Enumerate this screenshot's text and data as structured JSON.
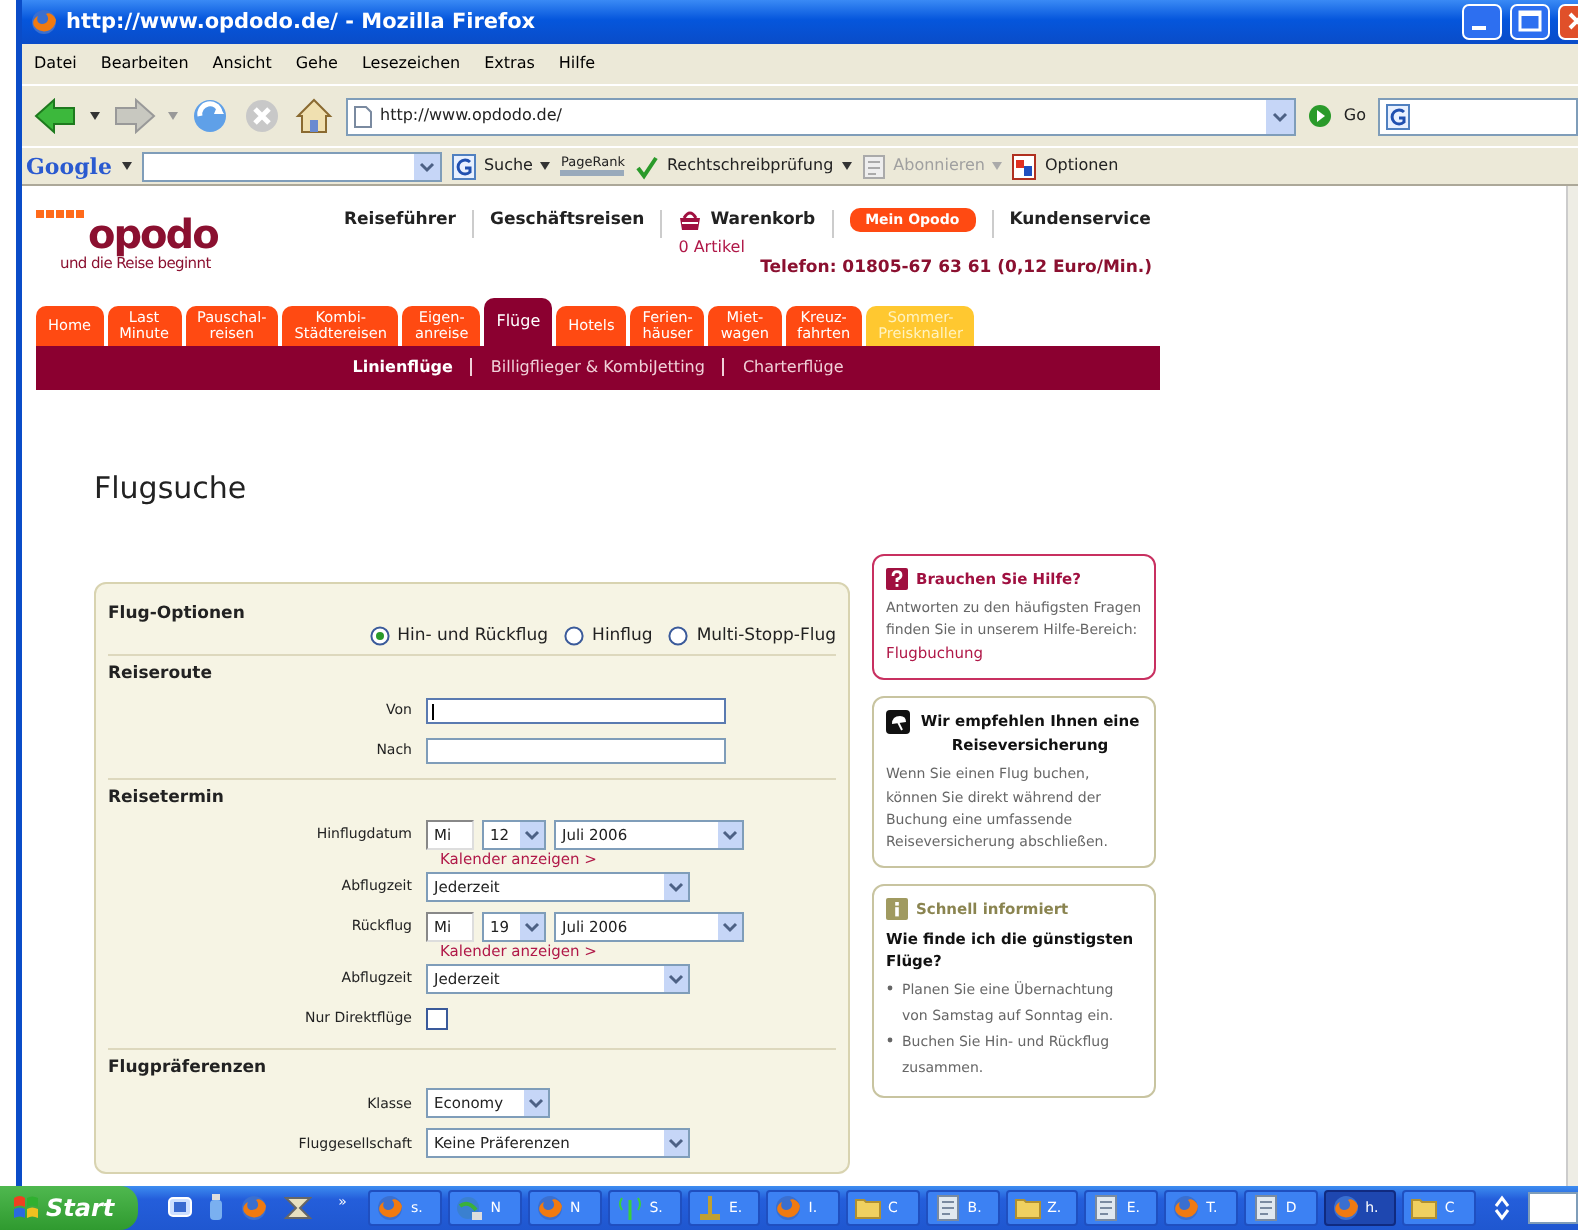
{
  "window": {
    "title": "http://www.opdodo.de/ - Mozilla Firefox"
  },
  "menu": [
    "Datei",
    "Bearbeiten",
    "Ansicht",
    "Gehe",
    "Lesezeichen",
    "Extras",
    "Hilfe"
  ],
  "address_bar": {
    "url": "http://www.opdodo.de/",
    "go": "Go"
  },
  "google_toolbar": {
    "logo": "Google",
    "items": [
      {
        "kind": "search",
        "label": "Suche",
        "disabled": false
      },
      {
        "kind": "pagerank",
        "label": "PageRank",
        "disabled": false
      },
      {
        "kind": "spell",
        "label": "Rechtschreibprüfung",
        "disabled": false
      },
      {
        "kind": "subscribe",
        "label": "Abonnieren",
        "disabled": true
      },
      {
        "kind": "options",
        "label": "Optionen",
        "disabled": false
      }
    ]
  },
  "site": {
    "logo": "opodo",
    "tagline": "und die Reise beginnt",
    "links": [
      {
        "kind": "link",
        "label": "Reiseführer"
      },
      {
        "kind": "link",
        "label": "Geschäftsreisen"
      },
      {
        "kind": "cart",
        "label": "Warenkorb",
        "count": "0 Artikel"
      },
      {
        "kind": "button",
        "label": "Mein Opodo"
      },
      {
        "kind": "link",
        "label": "Kundenservice"
      }
    ],
    "phone": "Telefon: 01805-67 63 61 (0,12 Euro/Min.)"
  },
  "tabs": [
    {
      "label": "Home",
      "kind": "normal",
      "selected": false
    },
    {
      "label": "Last\nMinute",
      "kind": "normal",
      "selected": false
    },
    {
      "label": "Pauschal-\nreisen",
      "kind": "normal",
      "selected": false
    },
    {
      "label": "Kombi-\nStädtereisen",
      "kind": "normal",
      "selected": false
    },
    {
      "label": "Eigen-\nanreise",
      "kind": "normal",
      "selected": false
    },
    {
      "label": "Flüge",
      "kind": "normal",
      "selected": true
    },
    {
      "label": "Hotels",
      "kind": "normal",
      "selected": false
    },
    {
      "label": "Ferien-\nhäuser",
      "kind": "normal",
      "selected": false
    },
    {
      "label": "Miet-\nwagen",
      "kind": "normal",
      "selected": false
    },
    {
      "label": "Kreuz-\nfahrten",
      "kind": "normal",
      "selected": false
    },
    {
      "label": "Sommer-\nPreisknaller",
      "kind": "promo",
      "selected": false
    }
  ],
  "subnav": [
    {
      "label": "Linienflüge",
      "selected": true
    },
    {
      "label": "Billigflieger & KombiJetting",
      "selected": false
    },
    {
      "label": "Charterflüge",
      "selected": false
    }
  ],
  "heading": "Flugsuche",
  "form": {
    "sections": [
      {
        "title": "Flug-Optionen",
        "rows": [
          {
            "kind": "radios",
            "options": [
              {
                "label": "Hin- und Rückflug",
                "selected": true
              },
              {
                "label": "Hinflug",
                "selected": false
              },
              {
                "label": "Multi-Stopp-Flug",
                "selected": false
              }
            ]
          }
        ]
      },
      {
        "title": "Reiseroute",
        "rows": [
          {
            "kind": "text",
            "label": "Von",
            "focused": true
          },
          {
            "kind": "text",
            "label": "Nach",
            "focused": false
          }
        ]
      },
      {
        "title": "Reisetermin",
        "rows": [
          {
            "kind": "date",
            "label": "Hinflugdatum",
            "weekday": "Mi",
            "day": "12",
            "month": "Juli 2006",
            "link": "Kalender anzeigen >"
          },
          {
            "kind": "select",
            "label": "Abflugzeit",
            "value": "Jederzeit"
          },
          {
            "kind": "date",
            "label": "Rückflug",
            "weekday": "Mi",
            "day": "19",
            "month": "Juli 2006",
            "link": "Kalender anzeigen >"
          },
          {
            "kind": "select",
            "label": "Abflugzeit",
            "value": "Jederzeit"
          },
          {
            "kind": "checkbox",
            "label": "Nur Direktflüge",
            "checked": false
          }
        ]
      },
      {
        "title": "Flugpräferenzen",
        "rows": [
          {
            "kind": "short-select",
            "label": "Klasse",
            "value": "Economy"
          },
          {
            "kind": "select",
            "label": "Fluggesellschaft",
            "value": "Keine Präferenzen"
          }
        ]
      }
    ]
  },
  "sidebar": [
    {
      "kind": "help",
      "title": "Brauchen Sie Hilfe?",
      "text": "Antworten zu den häufigsten Fragen finden Sie in unserem Hilfe-Bereich:",
      "link": "Flugbuchung"
    },
    {
      "kind": "insurance",
      "title": "Wir empfehlen Ihnen eine Reiseversicherung",
      "text": "Wenn Sie einen Flug buchen, können Sie direkt während der Buchung eine umfassende Reiseversicherung abschließen."
    },
    {
      "kind": "info",
      "title": "Schnell informiert",
      "subtitle": "Wie finde ich die günstigsten Flüge?",
      "bullets": [
        "Planen Sie eine Übernachtung von Samstag auf Sonntag ein.",
        "Buchen Sie Hin- und Rückflug zusammen."
      ]
    }
  ],
  "taskbar": {
    "start": "Start",
    "more": "»",
    "buttons": [
      {
        "label": "s.",
        "kind": "browser",
        "selected": false
      },
      {
        "label": "N",
        "kind": "network",
        "selected": false
      },
      {
        "label": "N",
        "kind": "browser",
        "selected": false
      },
      {
        "label": "S.",
        "kind": "antenna",
        "selected": false
      },
      {
        "label": "E.",
        "kind": "stand",
        "selected": false
      },
      {
        "label": "I.",
        "kind": "browser",
        "selected": false
      },
      {
        "label": "C",
        "kind": "folder",
        "selected": false
      },
      {
        "label": "B.",
        "kind": "document",
        "selected": false
      },
      {
        "label": "Z.",
        "kind": "folder",
        "selected": false
      },
      {
        "label": "E.",
        "kind": "document",
        "selected": false
      },
      {
        "label": "T.",
        "kind": "browser",
        "selected": false
      },
      {
        "label": "D",
        "kind": "document",
        "selected": false
      },
      {
        "label": "h.",
        "kind": "browser",
        "selected": true
      },
      {
        "label": "C",
        "kind": "folder",
        "selected": false
      }
    ]
  }
}
